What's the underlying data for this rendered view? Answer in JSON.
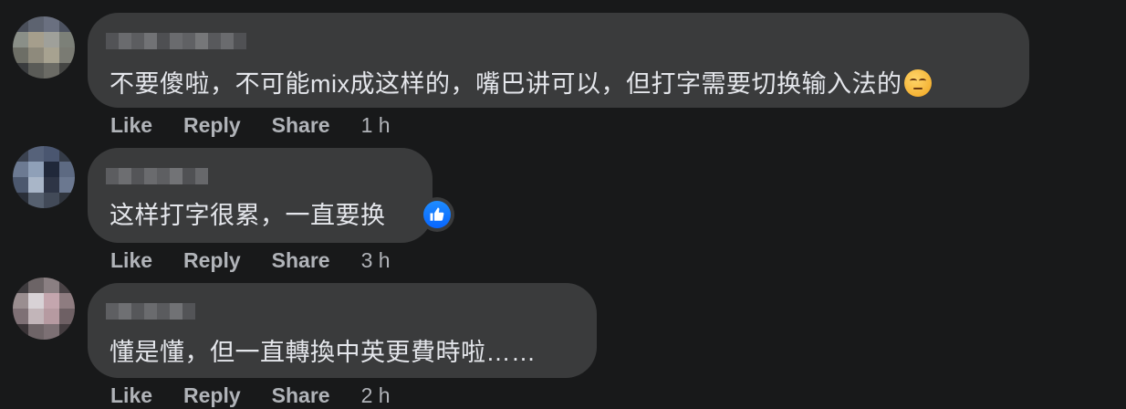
{
  "comments": [
    {
      "text": "不要傻啦，不可能mix成这样的，嘴巴讲可以，但打字需要切换输入法的",
      "emoji": "smirk-emoji",
      "actions": {
        "like": "Like",
        "reply": "Reply",
        "share": "Share"
      },
      "time": "1 h"
    },
    {
      "text": "这样打字很累，一直要换",
      "reaction": "like-reaction",
      "actions": {
        "like": "Like",
        "reply": "Reply",
        "share": "Share"
      },
      "time": "3 h"
    },
    {
      "text": "懂是懂，但一直轉換中英更費時啦……",
      "actions": {
        "like": "Like",
        "reply": "Reply",
        "share": "Share"
      },
      "time": "2 h"
    }
  ]
}
